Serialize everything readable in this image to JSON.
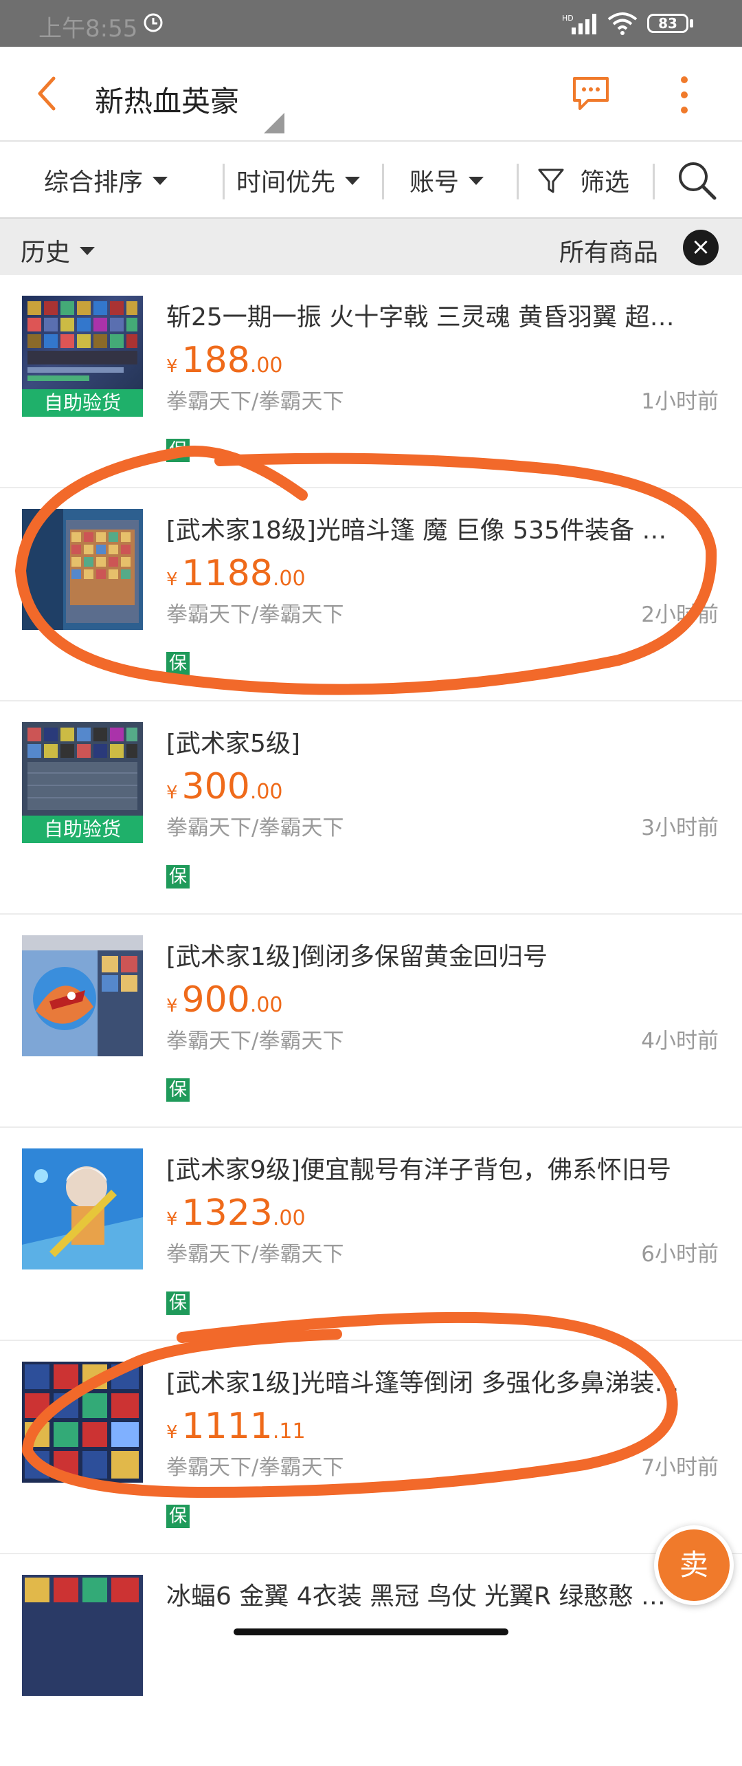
{
  "status_bar": {
    "time": "上午8:55",
    "network": "HD",
    "battery": "83"
  },
  "header": {
    "title": "新热血英豪",
    "back_icon": "chevron-left-icon",
    "message_icon": "chat-bubble-icon",
    "more_icon": "more-vertical-icon",
    "accent": "#f07a2b"
  },
  "filters": {
    "sort": "综合排序",
    "time": "时间优先",
    "type": "账号",
    "filter": "筛选"
  },
  "history_bar": {
    "history": "历史",
    "all_goods": "所有商品",
    "close": "×"
  },
  "items": [
    {
      "title": "斩25一期一振 火十字戟 三灵魂 黄昏羽翼 超…",
      "yen": "¥",
      "price_main": "188",
      "price_dec": ".00",
      "seller": "拳霸天下/拳霸天下",
      "time": "1小时前",
      "badge": "自助验货",
      "bao": "保"
    },
    {
      "title": "[武术家18级]光暗斗篷 魔 巨像 535件装备 …",
      "yen": "¥",
      "price_main": "1188",
      "price_dec": ".00",
      "seller": "拳霸天下/拳霸天下",
      "time": "2小时前",
      "badge": "",
      "bao": "保"
    },
    {
      "title": "[武术家5级]",
      "yen": "¥",
      "price_main": "300",
      "price_dec": ".00",
      "seller": "拳霸天下/拳霸天下",
      "time": "3小时前",
      "badge": "自助验货",
      "bao": "保"
    },
    {
      "title": "[武术家1级]倒闭多保留黄金回归号",
      "yen": "¥",
      "price_main": "900",
      "price_dec": ".00",
      "seller": "拳霸天下/拳霸天下",
      "time": "4小时前",
      "badge": "",
      "bao": "保"
    },
    {
      "title": "[武术家9级]便宜靓号有洋子背包，佛系怀旧号",
      "yen": "¥",
      "price_main": "1323",
      "price_dec": ".00",
      "seller": "拳霸天下/拳霸天下",
      "time": "6小时前",
      "badge": "",
      "bao": "保"
    },
    {
      "title": "[武术家1级]光暗斗篷等倒闭 多强化多鼻涕装…",
      "yen": "¥",
      "price_main": "1111",
      "price_dec": ".11",
      "seller": "拳霸天下/拳霸天下",
      "time": "7小时前",
      "badge": "",
      "bao": "保"
    },
    {
      "title": "冰蝠6 金翼 4衣装 黑冠 鸟仗 光翼R 绿憨憨 …",
      "yen": "",
      "price_main": "",
      "price_dec": "",
      "seller": "",
      "time": "",
      "badge": "",
      "bao": ""
    }
  ],
  "fab": {
    "label": "卖"
  }
}
